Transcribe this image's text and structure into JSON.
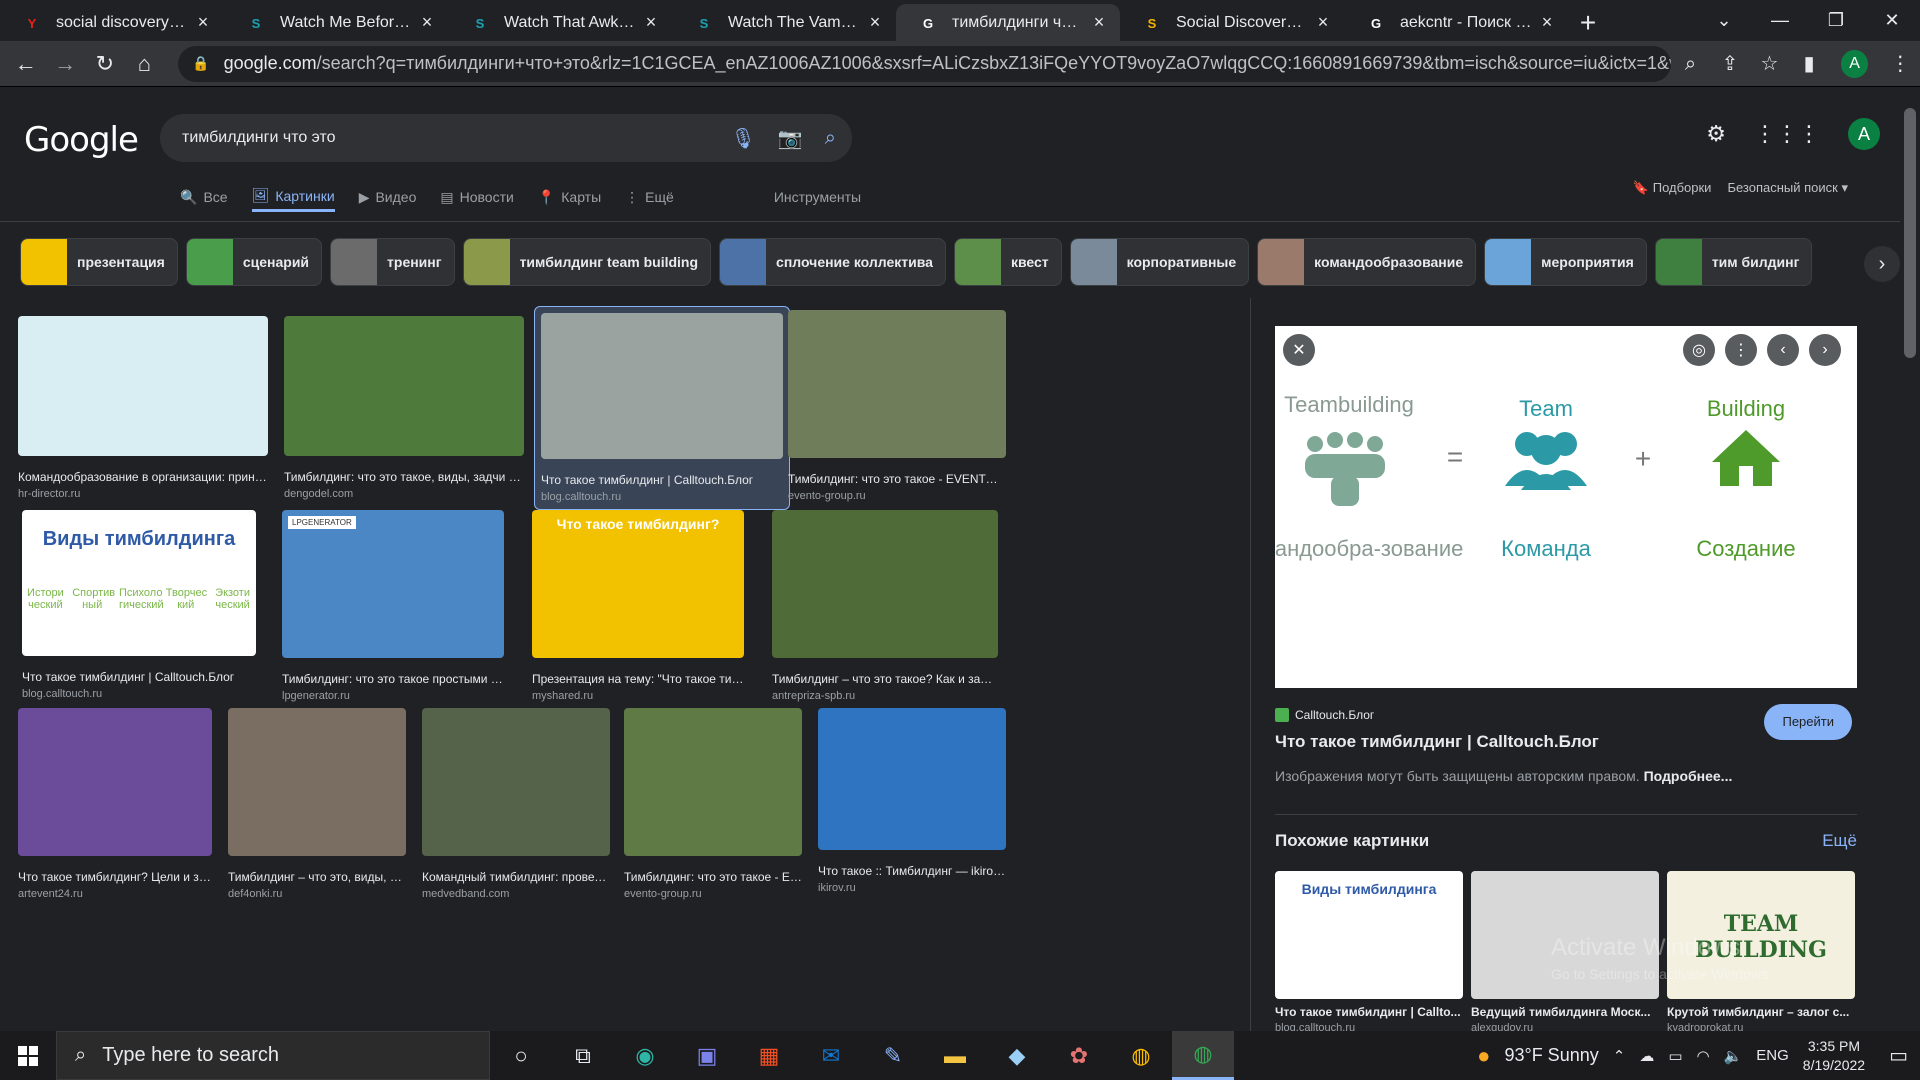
{
  "browser": {
    "tabs": [
      {
        "title": "social discovery ventu",
        "fav": "Y",
        "fav_color": "#e62117"
      },
      {
        "title": "Watch Me Before You",
        "fav": "S",
        "fav_color": "#1aa3b4"
      },
      {
        "title": "Watch That Awkward",
        "fav": "S",
        "fav_color": "#1aa3b4"
      },
      {
        "title": "Watch The Vampire D",
        "fav": "S",
        "fav_color": "#1aa3b4"
      },
      {
        "title": "тимбилдинги что это",
        "fav": "G",
        "fav_color": "#ffffff",
        "active": true
      },
      {
        "title": "Social Discovery Vent",
        "fav": "S",
        "fav_color": "#f4b400"
      },
      {
        "title": "aekcntr - Поиск в Go",
        "fav": "G",
        "fav_color": "#ffffff"
      }
    ],
    "url_domain": "google.com",
    "url_rest": "/search?q=тимбилдинги+что+это&rlz=1C1GCEA_enAZ1006AZ1006&sxsrf=ALiCzsbxZ13iFQeYYOT9voyZaO7wlqgCCQ:1660891669739&tbm=isch&source=iu&ictx=1&vet=...",
    "profile_initial": "A"
  },
  "google": {
    "logo": "Google",
    "query": "тимбилдинги что это",
    "profile_initial": "A",
    "tabs": [
      {
        "label": "Все",
        "icon": "🔍"
      },
      {
        "label": "Картинки",
        "icon": "🖼",
        "active": true
      },
      {
        "label": "Видео",
        "icon": "▶"
      },
      {
        "label": "Новости",
        "icon": "▤"
      },
      {
        "label": "Карты",
        "icon": "📍"
      },
      {
        "label": "Ещё",
        "icon": "⋮"
      }
    ],
    "tools": "Инструменты",
    "collections": "Подборки",
    "safe_search": "Безопасный поиск ▾"
  },
  "chips": [
    {
      "label": "презентация",
      "color": "#f2c200"
    },
    {
      "label": "сценарий",
      "color": "#4a9d4a"
    },
    {
      "label": "тренинг",
      "color": "#6b6b6b"
    },
    {
      "label": "тимбилдинг team building",
      "color": "#8a9a4a"
    },
    {
      "label": "сплочение коллектива",
      "color": "#4d72a8"
    },
    {
      "label": "квест",
      "color": "#5e8f4a"
    },
    {
      "label": "корпоративные",
      "color": "#7a8a9a"
    },
    {
      "label": "командообразование",
      "color": "#9a7a6a"
    },
    {
      "label": "мероприятия",
      "color": "#6aa4d8"
    },
    {
      "label": "тим билдинг",
      "color": "#3f7f3f"
    }
  ],
  "results": [
    {
      "caption": "Командообразование в организации: принципы, ...",
      "source": "hr-director.ru",
      "color": "#d9eef3"
    },
    {
      "caption": "Тимбилдинг: что это такое, виды, задчи и прим...",
      "source": "dengodel.com",
      "color": "#4e7a3c"
    },
    {
      "caption": "Что такое тимбилдинг | Calltouch.Блог",
      "source": "blog.calltouch.ru",
      "color": "#9aa3a0",
      "selected": true
    },
    {
      "caption": "Тимбилдинг: что это такое - EVENTO | Even...",
      "source": "evento-group.ru",
      "color": "#6f7d5a"
    },
    {
      "caption": "Что такое тимбилдинг | Calltouch.Блог",
      "source": "blog.calltouch.ru",
      "color": "#ffffff"
    },
    {
      "caption": "Тимбилдинг: что это такое простыми словами",
      "source": "lpgenerator.ru",
      "color": "#4b86c5"
    },
    {
      "caption": "Презентация на тему: \"Что такое тимбилди...",
      "source": "myshared.ru",
      "color": "#f2c200"
    },
    {
      "caption": "Тимбилдинг – что это такое? Как и зачем пров...",
      "source": "antrepriza-spb.ru",
      "color": "#4f6b38"
    },
    {
      "caption": "Что такое тимбилдинг? Цели и задач...",
      "source": "artevent24.ru",
      "color": "#6b4c9a"
    },
    {
      "caption": "Тимбилдинг – что это, виды, назн...",
      "source": "def4onki.ru",
      "color": "#7a6e62"
    },
    {
      "caption": "Командный тимбилдинг: проведени...",
      "source": "medvedband.com",
      "color": "#55634a"
    },
    {
      "caption": "Тимбилдинг: что это такое - EVEN...",
      "source": "evento-group.ru",
      "color": "#5f7a44"
    },
    {
      "caption": "Что такое :: Тимбилдинг — ikirov.ru - ...",
      "source": "ikirov.ru",
      "color": "#2f74c0"
    }
  ],
  "thumb_text": {
    "vidy_title": "Виды тимбилдинга",
    "vidy_items": [
      "Истори ческий",
      "Спортив ный",
      "Психоло гический",
      "Творчес кий",
      "Экзоти ческий"
    ],
    "presentation_title": "Что такое тимбилдинг?",
    "lpgen_badge": "LPGENERATOR"
  },
  "preview": {
    "site": "Calltouch.Блог",
    "title": "Что такое тимбилдинг | Calltouch.Блог",
    "go_label": "Перейти",
    "copyright": "Изображения могут быть защищены авторским правом.",
    "copyright_more": "Подробнее...",
    "similar_title": "Похожие картинки",
    "similar_more": "Ещё",
    "image_text": {
      "teambuilding": "Teambuilding",
      "team": "Team",
      "building": "Building",
      "eq": "=",
      "plus": "+",
      "komandoobr": "Командообра-зование",
      "komanda": "Команда",
      "sozdanie": "Создание"
    },
    "similar": [
      {
        "caption": "Что такое тимбилдинг | Callto...",
        "source": "blog.calltouch.ru",
        "color": "#ffffff"
      },
      {
        "caption": "Ведущий тимбилдинга Моск...",
        "source": "alexgudov.ru",
        "color": "#d8d8d8"
      },
      {
        "caption": "Крутой тимбилдинг – залог с...",
        "source": "kvadroprokat.ru",
        "color": "#f3f0e0"
      }
    ],
    "similar_word": "TEAM BUILDING",
    "watermark_title": "Activate Windows",
    "watermark_sub": "Go to Settings to activate Windows."
  },
  "taskbar": {
    "search_placeholder": "Type here to search",
    "weather": "93°F  Sunny",
    "lang": "ENG",
    "time": "3:35 PM",
    "date": "8/19/2022"
  }
}
